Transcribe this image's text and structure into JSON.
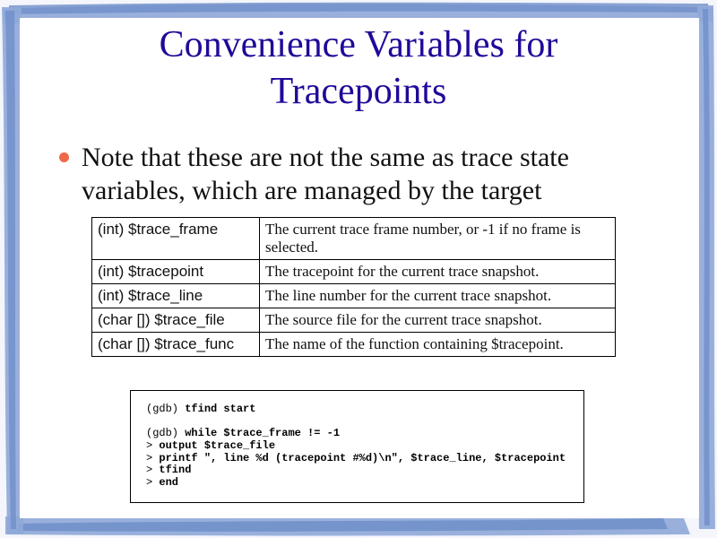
{
  "slide": {
    "title_line1": "Convenience Variables for",
    "title_line2": "Tracepoints",
    "bullet": "Note that these are not the same as trace state variables, which are managed by the target"
  },
  "table": {
    "rows": [
      {
        "name": "(int) $trace_frame",
        "desc": "The current trace frame number, or -1 if no frame is selected."
      },
      {
        "name": "(int) $tracepoint",
        "desc": "The tracepoint for the current trace snapshot."
      },
      {
        "name": "(int) $trace_line",
        "desc": "The line number for the current trace snapshot."
      },
      {
        "name": "(char []) $trace_file",
        "desc": "The source file for the current trace snapshot."
      },
      {
        "name": "(char []) $trace_func",
        "desc": "The name of the function containing $tracepoint."
      }
    ]
  },
  "code": {
    "lines": [
      {
        "prompt": "(gdb) ",
        "cmd": "tfind start"
      },
      {
        "prompt": "",
        "cmd": ""
      },
      {
        "prompt": "(gdb) ",
        "cmd": "while $trace_frame != -1"
      },
      {
        "prompt": "> ",
        "cmd": "output $trace_file"
      },
      {
        "prompt": "> ",
        "cmd": "printf \", line %d (tracepoint #%d)\\n\", $trace_line, $tracepoint"
      },
      {
        "prompt": "> ",
        "cmd": "tfind"
      },
      {
        "prompt": "> ",
        "cmd": "end"
      }
    ]
  },
  "colors": {
    "title": "#1f0a99",
    "bullet": "#f0694a",
    "frame": "#6f8fc9"
  }
}
